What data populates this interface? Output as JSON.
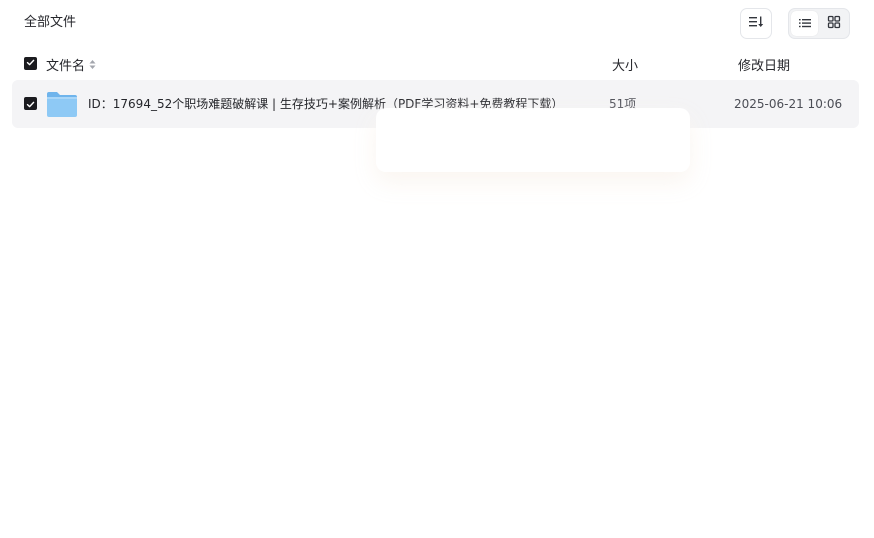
{
  "breadcrumb": {
    "label": "全部文件"
  },
  "toolbar": {
    "sort_icon": "sort-list-icon",
    "view_list_icon": "list-view-icon",
    "view_grid_icon": "grid-view-icon",
    "active_view": "list"
  },
  "table": {
    "columns": {
      "name": "文件名",
      "size": "大小",
      "date": "修改日期"
    },
    "select_all_checked": true,
    "rows": [
      {
        "checked": true,
        "type_icon": "folder-icon",
        "name": "ID：17694_52个职场难题破解课 | 生存技巧+案例解析（PDF学习资料+免费教程下载）",
        "size": "51项",
        "modified": "2025-06-21 10:06"
      }
    ]
  },
  "colors": {
    "row_selected_bg": "#f4f4f6",
    "checkbox_fill": "#1b1b1f",
    "folder_blue": "#8ec9f5",
    "text_primary": "#25262b",
    "text_secondary": "#4b4d55",
    "border": "#e4e6ea"
  }
}
